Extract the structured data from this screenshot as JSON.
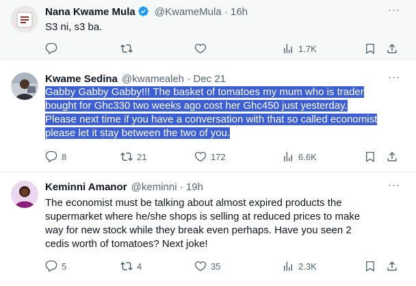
{
  "tweets": [
    {
      "name": "Nana Kwame Mula",
      "handle": "@KwameMula",
      "sep": "·",
      "time": "16h",
      "text": "S3 ni, s3 ba.",
      "replies": "",
      "retweets": "",
      "likes": "",
      "views": "1.7K",
      "verified": true
    },
    {
      "name": "Kwame Sedina",
      "handle": "@kwamealeh",
      "sep": "·",
      "time": "Dec 21",
      "text_lines": [
        "Gabby Gabby Gabby!!! The basket of tomatoes my mum who is trader",
        "bought for Ghc330 two weeks ago cost her Ghc450 just yesterday.",
        "Please next time if you have a conversation with that so called economist",
        "please let it stay between the two of you."
      ],
      "replies": "8",
      "retweets": "21",
      "likes": "172",
      "views": "6.6K"
    },
    {
      "name": "Keminni Amanor",
      "handle": "@keminni",
      "sep": "·",
      "time": "19h",
      "text": "The economist must be talking about almost expired products the supermarket where he/she shops is selling at reduced prices to make way for new stock while they break even perhaps. Have you seen 2 cedis worth of tomatoes? Next joke!",
      "replies": "5",
      "retweets": "4",
      "likes": "35",
      "views": "2.3K"
    }
  ],
  "icons": {
    "reply": "reply-icon",
    "retweet": "retweet-icon",
    "like": "heart-icon",
    "views": "views-icon",
    "bookmark": "bookmark-icon",
    "share": "share-icon",
    "more": "more-icon"
  },
  "colors": {
    "accent": "#1d9bf0",
    "highlight": "#3c5fd5",
    "muted": "#536471"
  }
}
